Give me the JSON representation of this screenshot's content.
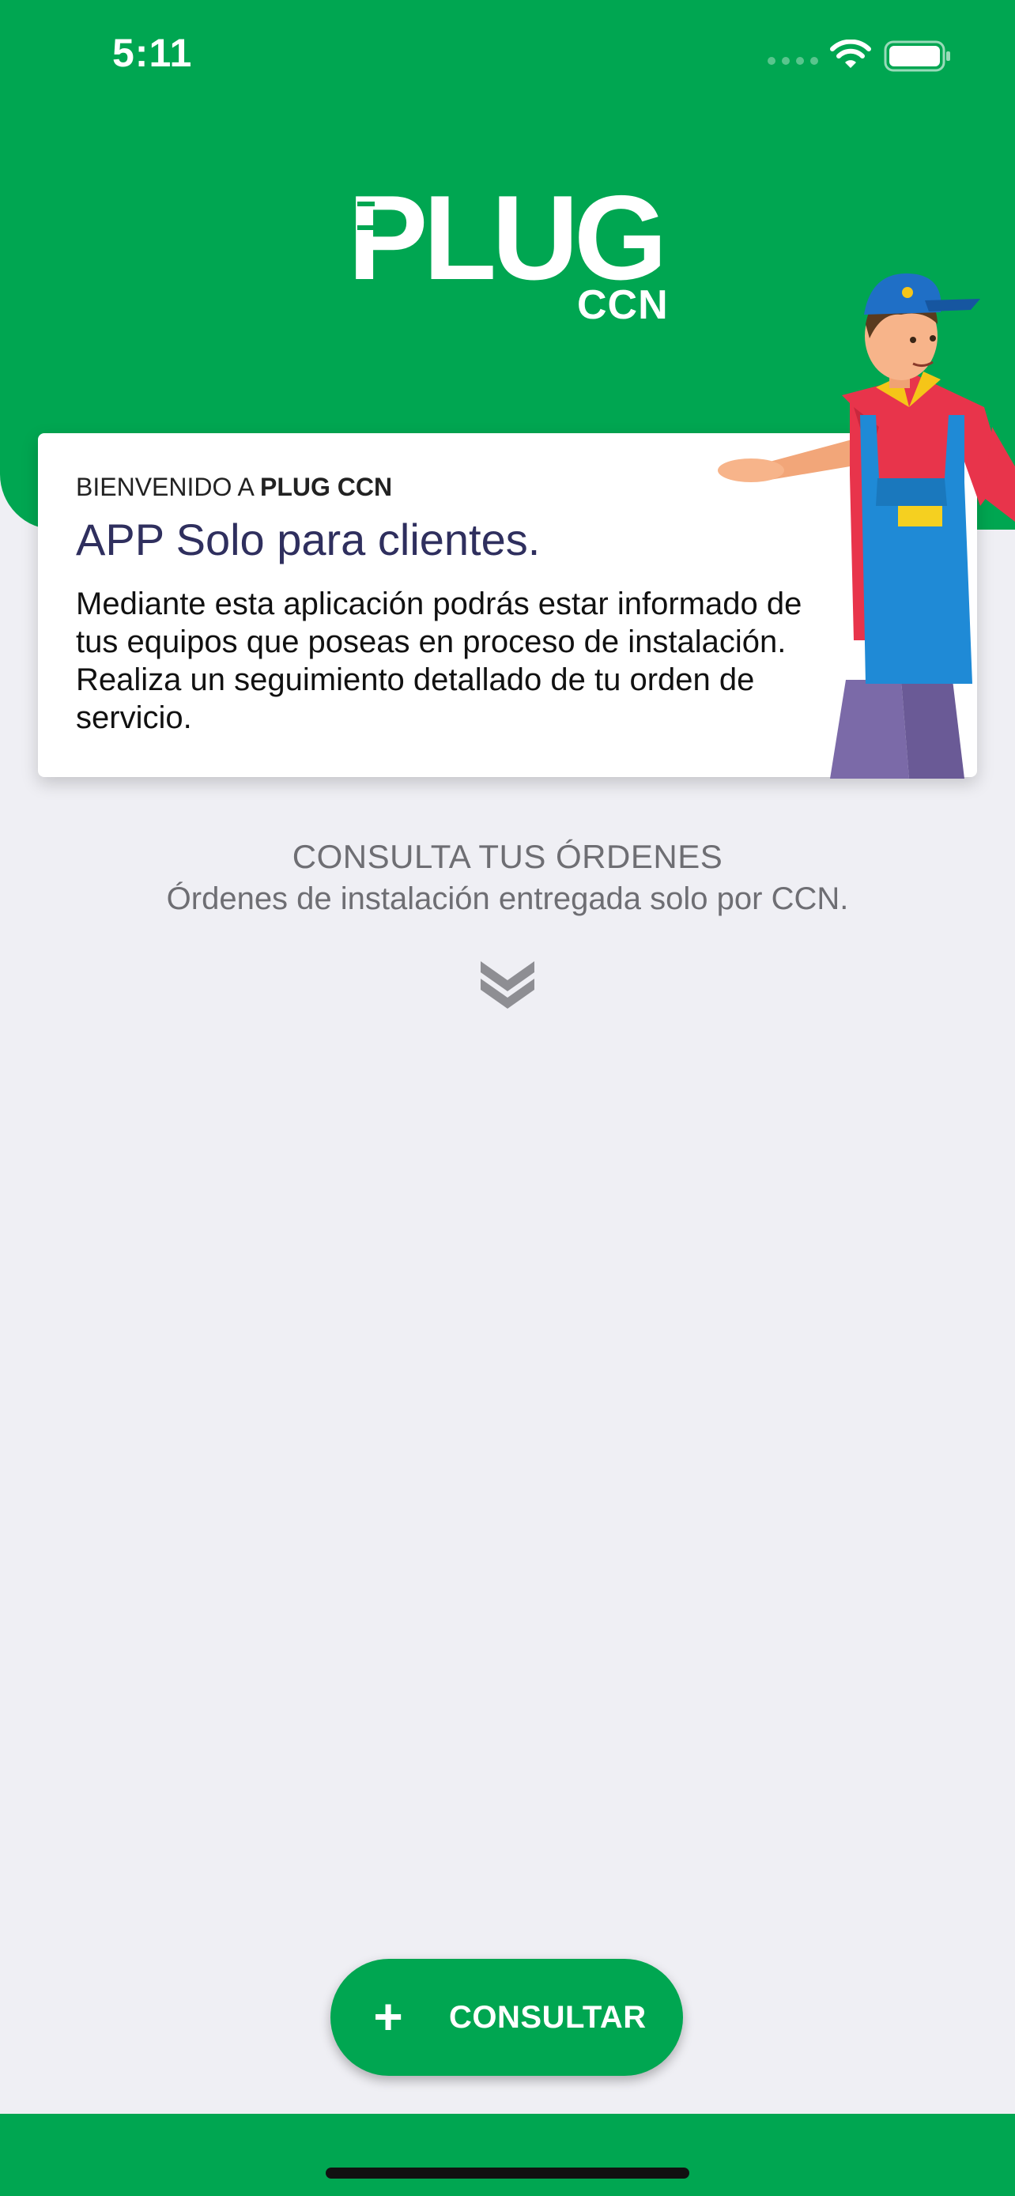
{
  "status_bar": {
    "time": "5:11"
  },
  "logo": {
    "main": "PLUG",
    "sub": "CCN"
  },
  "welcome_card": {
    "kicker_prefix": "BIENVENIDO A ",
    "kicker_brand": "PLUG CCN",
    "title": "APP Solo para clientes.",
    "body": "Mediante esta aplicación podrás estar informado de tus equipos que poseas en proceso de instalación. Realiza un seguimiento detallado de tu orden de servicio."
  },
  "orders_section": {
    "title": "CONSULTA TUS ÓRDENES",
    "subtitle": "Órdenes de instalación entregada solo por CCN.",
    "icon": "double-chevron-down-icon"
  },
  "consult_button": {
    "label": "CONSULTAR",
    "icon": "plus-icon"
  },
  "colors": {
    "brand_green": "#00a651",
    "background": "#efeff4",
    "title_navy": "#2f2f5e",
    "muted_text": "#6e6e73"
  }
}
